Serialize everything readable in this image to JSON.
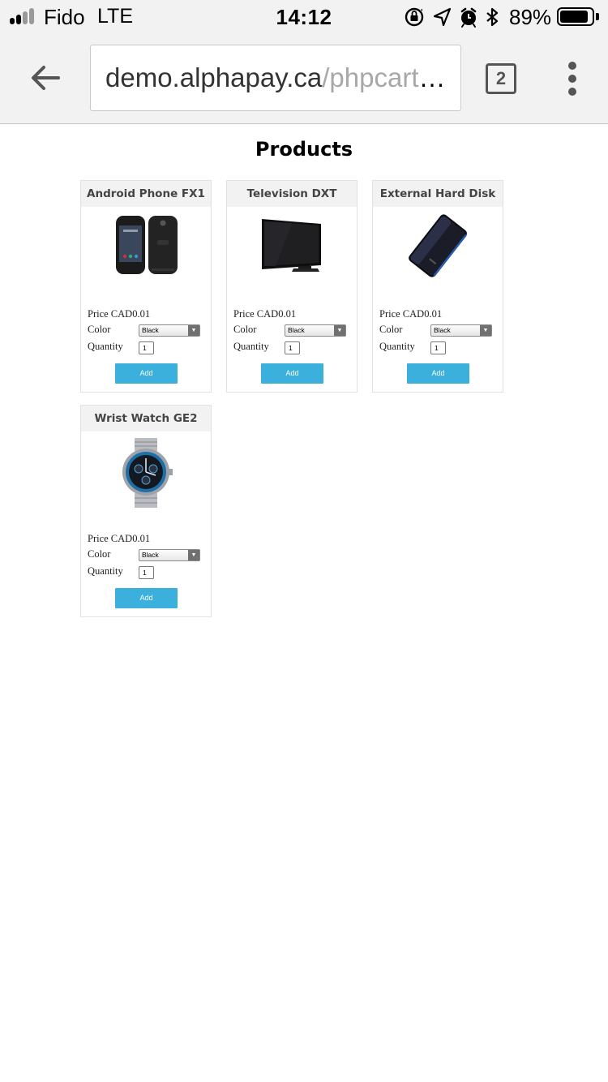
{
  "status_bar": {
    "carrier": "Fido",
    "network": "LTE",
    "time": "14:12",
    "battery_percent": "89%",
    "battery_level": 0.89,
    "icons": [
      "signal-icon",
      "orientation-lock-icon",
      "location-icon",
      "alarm-icon",
      "bluetooth-icon",
      "battery-icon"
    ]
  },
  "browser": {
    "url_host": "demo.alphapay.ca",
    "url_path": "/phpcartdemo",
    "tab_count": "2",
    "icons": [
      "back-arrow-icon",
      "more-vert-icon"
    ]
  },
  "page": {
    "title": "Products",
    "products": [
      {
        "name": "Android Phone FX1",
        "price": "Price CAD0.01",
        "color_label": "Color",
        "color_value": "Black",
        "quantity_label": "Quantity",
        "quantity_value": "1",
        "button": "Add",
        "image": "phone-image"
      },
      {
        "name": "Television DXT",
        "price": "Price CAD0.01",
        "color_label": "Color",
        "color_value": "Black",
        "quantity_label": "Quantity",
        "quantity_value": "1",
        "button": "Add",
        "image": "television-image"
      },
      {
        "name": "External Hard Disk",
        "price": "Price CAD0.01",
        "color_label": "Color",
        "color_value": "Black",
        "quantity_label": "Quantity",
        "quantity_value": "1",
        "button": "Add",
        "image": "hard-disk-image"
      },
      {
        "name": "Wrist Watch GE2",
        "price": "Price CAD0.01",
        "color_label": "Color",
        "color_value": "Black",
        "quantity_label": "Quantity",
        "quantity_value": "1",
        "button": "Add",
        "image": "watch-image"
      }
    ]
  },
  "colors": {
    "chrome_bg": "#f2f2f2",
    "add_button": "#3bb0dd",
    "card_header_bg": "#f2f2f2"
  }
}
